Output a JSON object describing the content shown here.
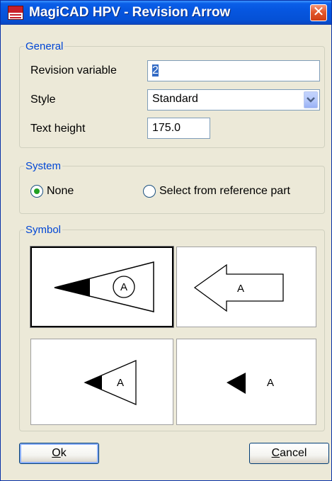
{
  "window": {
    "title": "MagiCAD HPV - Revision Arrow",
    "icon": "magicad-app-icon",
    "close_glyph": "✕"
  },
  "general": {
    "legend": "General",
    "revision_variable_label": "Revision variable",
    "revision_variable_value": "2",
    "style_label": "Style",
    "style_value": "Standard",
    "text_height_label": "Text height",
    "text_height_value": "175.0"
  },
  "system": {
    "legend": "System",
    "none_label": "None",
    "none_checked": true,
    "select_ref_label": "Select from reference part",
    "select_ref_checked": false
  },
  "symbol": {
    "legend": "Symbol",
    "letter": "A",
    "selected_index": 0
  },
  "buttons": {
    "ok_label_hot": "O",
    "ok_label_rest": "k",
    "cancel_label_hot": "C",
    "cancel_label_rest": "ancel"
  },
  "colors": {
    "titlebar": "#0A5FE8",
    "group_legend": "#0046D5",
    "dialog_bg": "#ECE9D8",
    "selection": "#316AC5",
    "radio_dot": "#21A121"
  }
}
